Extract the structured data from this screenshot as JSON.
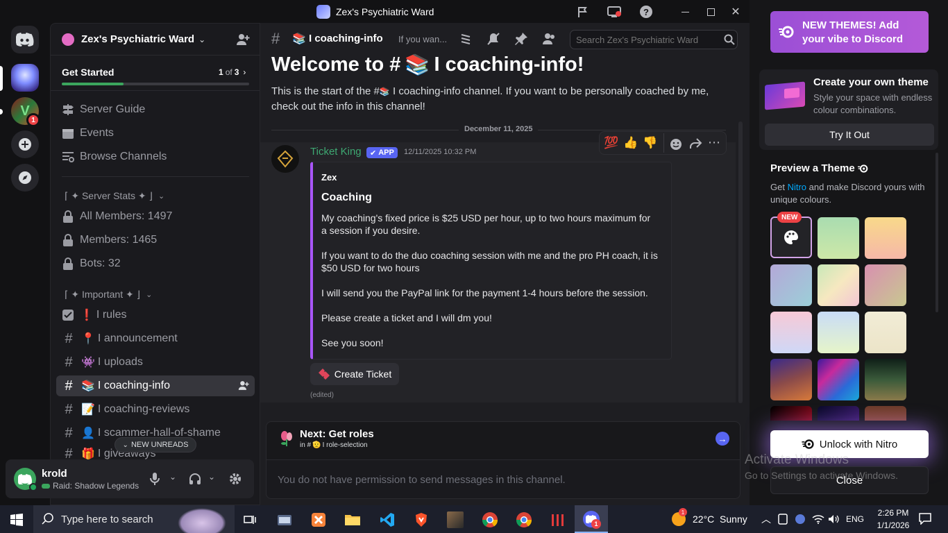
{
  "window": {
    "title": "Zex's Psychiatric Ward"
  },
  "server": {
    "name": "Zex's Psychiatric Ward",
    "get_started": {
      "label": "Get Started",
      "progress_current": "1",
      "progress_of": "of",
      "progress_total": "3",
      "progress_fraction": 0.33
    },
    "nav": [
      {
        "label": "Server Guide",
        "icon": "signpost-icon"
      },
      {
        "label": "Events",
        "icon": "calendar-icon"
      },
      {
        "label": "Browse Channels",
        "icon": "browse-icon"
      }
    ],
    "categories": [
      {
        "label": "⌈ ✦ Server Stats ✦ ⌋"
      },
      {
        "label": "⌈ ✦ Important ✦ ⌋"
      }
    ],
    "stats_channels": [
      "All Members: 1497",
      "Members: 1465",
      "Bots: 32"
    ],
    "channels": [
      {
        "emoji": "❗",
        "name": "I rules"
      },
      {
        "emoji": "📍",
        "name": "I announcement"
      },
      {
        "emoji": "👾",
        "name": "I uploads"
      },
      {
        "emoji": "📚",
        "name": "I coaching-info"
      },
      {
        "emoji": "📝",
        "name": "I coaching-reviews"
      },
      {
        "emoji": "👤",
        "name": "I scammer-hall-of-shame"
      },
      {
        "emoji": "🎁",
        "name": "I giveaways"
      }
    ],
    "new_unreads": "NEW UNREADS"
  },
  "user": {
    "name": "krold",
    "status": "Raid: Shadow Legends"
  },
  "rail": {
    "badge": "1"
  },
  "channel": {
    "name": "I coaching-info",
    "topic": "If you wan...",
    "search_placeholder": "Search Zex's Psychiatric Ward",
    "welcome_prefix": "Welcome to #",
    "welcome_name": " I coaching-info!",
    "intro_a": "This is the start of the #",
    "intro_b": " I coaching-info channel. If you want to be personally coached by me, check out the info in this channel!",
    "date_divider": "December 11, 2025"
  },
  "message": {
    "author": "Ticket King",
    "app_tag": "APP",
    "timestamp": "12/11/2025 10:32 PM",
    "reactions": [
      "💯",
      "👍",
      "👎"
    ],
    "embed": {
      "author": "Zex",
      "title": "Coaching",
      "paragraphs": [
        "My coaching's fixed price is $25 USD per hour, up to two hours maximum for a session if you desire.",
        "If you want to do the duo coaching session with me and the pro PH coach, it is $50 USD for two hours",
        "I will send you the PayPal link for the payment 1-4 hours before the session.",
        "Please create a ticket and I will dm you!",
        "See you soon!"
      ]
    },
    "button": "Create Ticket",
    "edited": "(edited)"
  },
  "next": {
    "title": "Next: Get roles",
    "in_prefix": "in #",
    "in_channel": " I role-selection"
  },
  "composer": {
    "placeholder": "You do not have permission to send messages in this channel."
  },
  "right_panel": {
    "banner": "NEW THEMES! Add your vibe to Discord",
    "create_title": "Create your own theme",
    "create_desc": "Style your space with endless colour combinations.",
    "try_button": "Try It Out",
    "preview_title": "Preview a Theme",
    "preview_desc_a": "Get ",
    "preview_desc_link": "Nitro",
    "preview_desc_b": " and make Discord yours with unique colours.",
    "new_badge": "NEW",
    "unlock_button": "Unlock with Nitro",
    "close_button": "Close",
    "swatches": [
      "#a9dcb0",
      "#f6c89a",
      "#a9b8d9",
      "#e9e6b0",
      "#d49aa8",
      "#f7c9d6",
      "#c9e8f5",
      "#f1ecd6",
      "#4b2a7a",
      "#2b3d9c",
      "#1f3a2a",
      "#1a0a0e",
      "#141b3a",
      "#6b3a2a"
    ]
  },
  "watermark": {
    "line1": "Activate Windows",
    "line2": "Go to Settings to activate Windows."
  },
  "taskbar": {
    "search": "Type here to search",
    "weather": "22°C  Sunny",
    "weather_badge": "1",
    "lang": "ENG",
    "time": "2:26 PM",
    "date": "1/1/2026",
    "discord_badge": "1"
  }
}
